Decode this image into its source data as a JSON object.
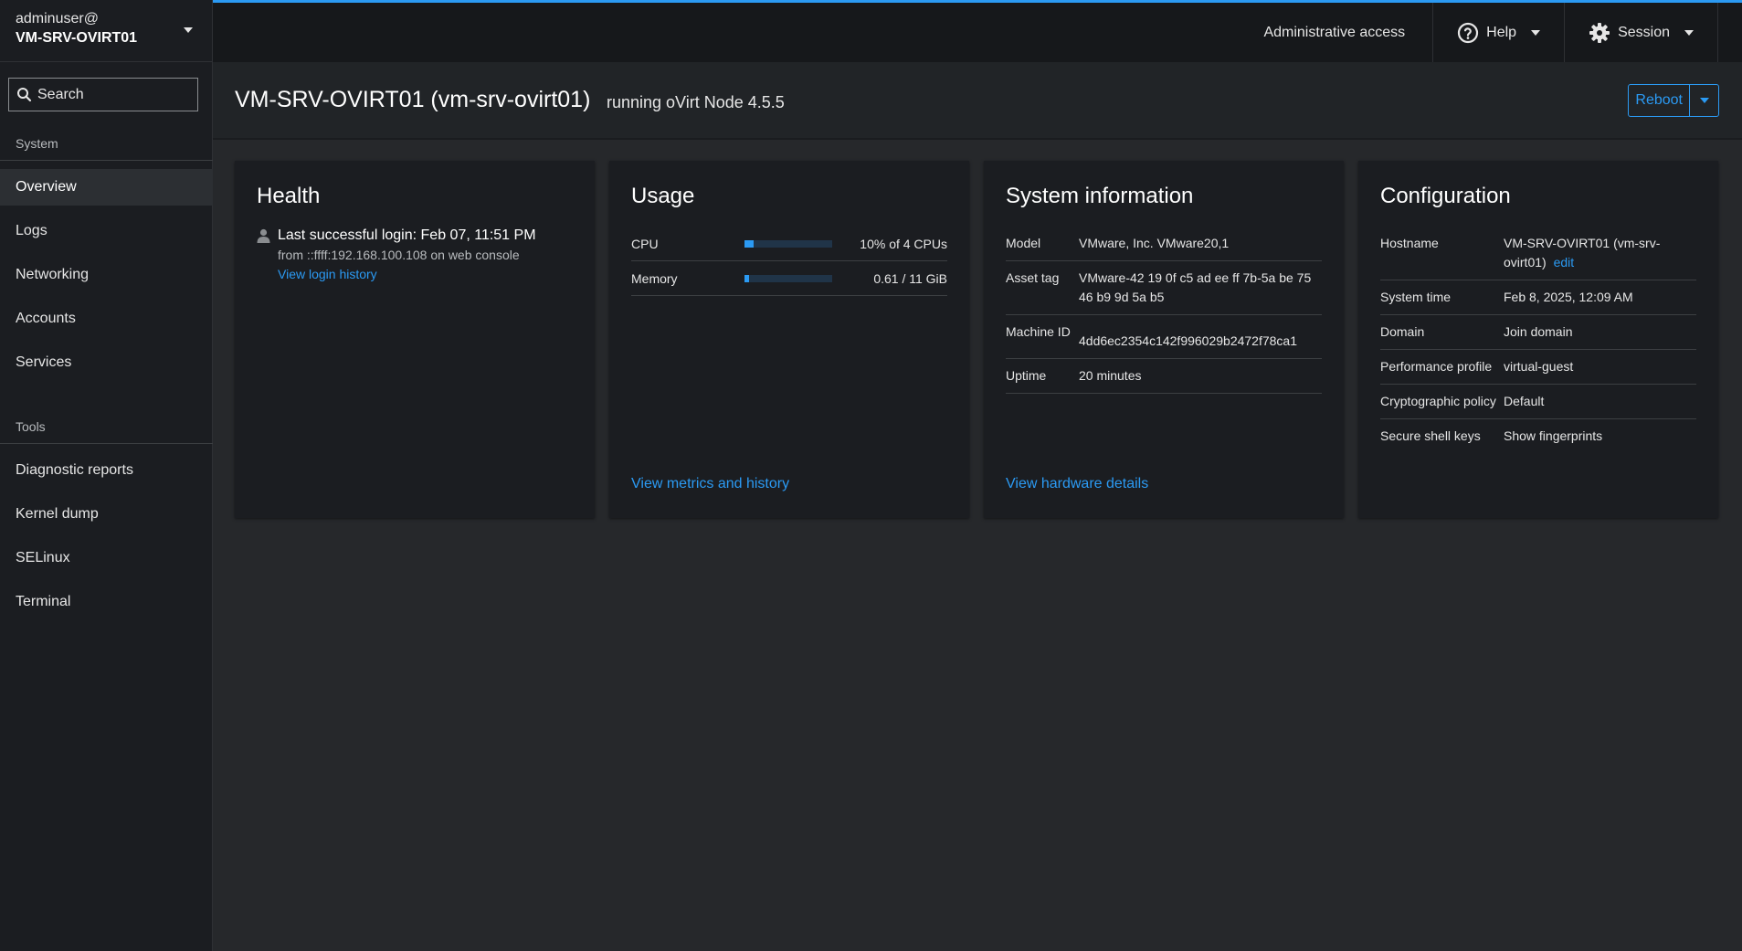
{
  "host": {
    "user": "adminuser@",
    "name": "VM-SRV-OVIRT01"
  },
  "search": {
    "placeholder": "Search"
  },
  "nav": {
    "system_label": "System",
    "system_items": [
      "Overview",
      "Logs",
      "Networking",
      "Accounts",
      "Services"
    ],
    "tools_label": "Tools",
    "tools_items": [
      "Diagnostic reports",
      "Kernel dump",
      "SELinux",
      "Terminal"
    ]
  },
  "topbar": {
    "admin_access": "Administrative access",
    "help": "Help",
    "session": "Session"
  },
  "page": {
    "title": "VM-SRV-OVIRT01 (vm-srv-ovirt01)",
    "subtitle": "running oVirt Node 4.5.5",
    "reboot": "Reboot"
  },
  "health": {
    "title": "Health",
    "login": "Last successful login: Feb 07, 11:51 PM",
    "from": "from ::ffff:192.168.100.108 on web console",
    "history_link": "View login history"
  },
  "usage": {
    "title": "Usage",
    "cpu_label": "CPU",
    "cpu_value": "10% of 4 CPUs",
    "cpu_fraction": 0.1,
    "mem_label": "Memory",
    "mem_value": "0.61 / 11 GiB",
    "mem_fraction": 0.055,
    "link": "View metrics and history"
  },
  "sysinfo": {
    "title": "System information",
    "rows": [
      {
        "label": "Model",
        "value": "VMware, Inc. VMware20,1"
      },
      {
        "label": "Asset tag",
        "value": "VMware-42 19 0f c5 ad ee ff 7b-5a be 75 46 b9 9d 5a b5"
      },
      {
        "label": "Machine ID",
        "value": "4dd6ec2354c142f996029b2472f78ca1"
      },
      {
        "label": "Uptime",
        "value": "20 minutes"
      }
    ],
    "link": "View hardware details"
  },
  "config": {
    "title": "Configuration",
    "hostname_label": "Hostname",
    "hostname_value": "VM-SRV-OVIRT01 (vm-srv-ovirt01)",
    "hostname_edit": "edit",
    "time_label": "System time",
    "time_value": "Feb 8, 2025, 12:09 AM",
    "domain_label": "Domain",
    "domain_value": "Join domain",
    "perf_label": "Performance profile",
    "perf_value": "virtual-guest",
    "crypto_label": "Cryptographic policy",
    "crypto_value": "Default",
    "ssh_label": "Secure shell keys",
    "ssh_value": "Show fingerprints"
  },
  "colors": {
    "accent": "#2b9af3",
    "background": "#26282b",
    "card": "#1b1d21"
  }
}
